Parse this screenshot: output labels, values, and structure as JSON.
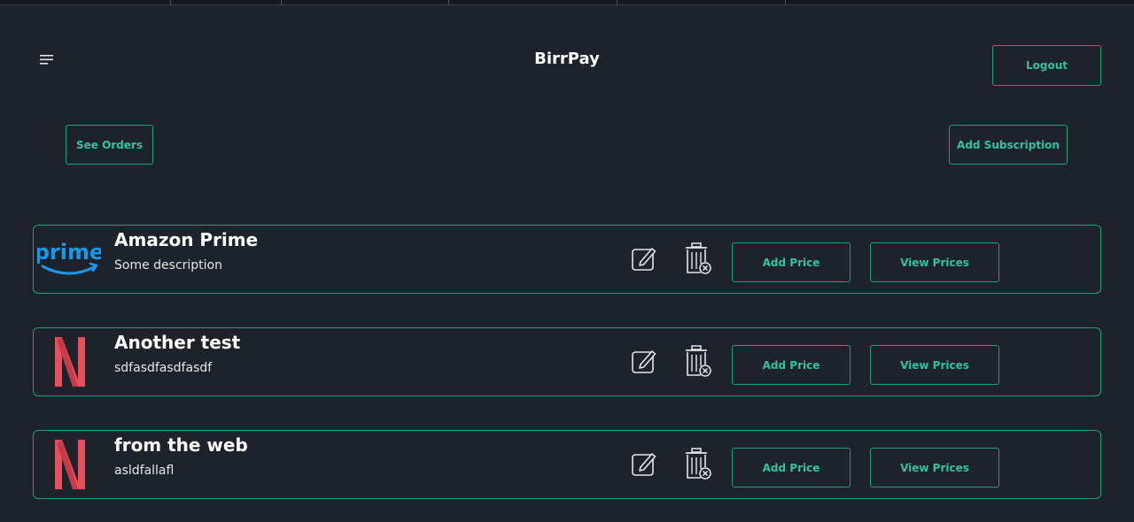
{
  "header": {
    "title": "BirrPay",
    "logout_label": "Logout"
  },
  "actions": {
    "see_orders_label": "See Orders",
    "add_subscription_label": "Add Subscription"
  },
  "subscriptions": [
    {
      "name": "Amazon Prime",
      "description": "Some description",
      "logo": "prime-logo",
      "add_price_label": "Add Price",
      "view_prices_label": "View Prices"
    },
    {
      "name": "Another test",
      "description": "sdfasdfasdfasdf",
      "logo": "netflix-logo",
      "add_price_label": "Add Price",
      "view_prices_label": "View Prices"
    },
    {
      "name": "from the web",
      "description": "asldfallafl",
      "logo": "netflix-logo",
      "add_price_label": "Add Price",
      "view_prices_label": "View Prices"
    }
  ],
  "logo_text": {
    "prime": "prime"
  },
  "colors": {
    "background": "#1e222a",
    "accent": "#16a37f",
    "accent_text": "#2cc5a0",
    "prime_blue": "#1a98e6",
    "netflix_red": "#e5505f"
  },
  "icons": [
    "menu-icon",
    "edit-icon",
    "trash-icon"
  ]
}
